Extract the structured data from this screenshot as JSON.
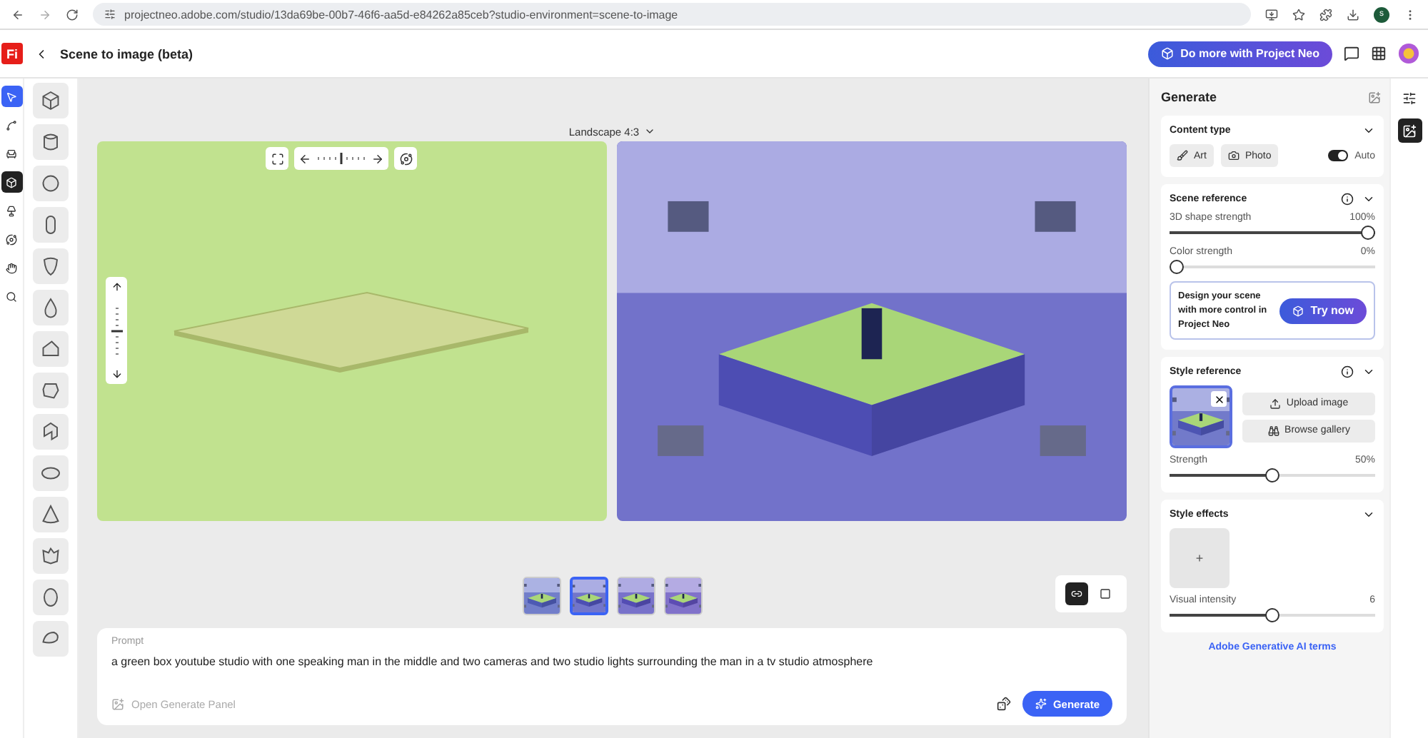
{
  "browser": {
    "url": "projectneo.adobe.com/studio/13da69be-00b7-46f6-aa5d-e84262a85ceb?studio-environment=scene-to-image",
    "avatar": "s"
  },
  "app": {
    "logo": "Fi",
    "title": "Scene to image (beta)",
    "promo_button": "Do more with Project Neo"
  },
  "tools": [
    {
      "kind": "pointer",
      "selected": true,
      "open": false
    },
    {
      "kind": "path",
      "selected": false,
      "open": false
    },
    {
      "kind": "objects",
      "selected": false,
      "open": false
    },
    {
      "kind": "cube",
      "selected": false,
      "open": true
    },
    {
      "kind": "lamp",
      "selected": false,
      "open": false
    },
    {
      "kind": "orbit",
      "selected": false,
      "open": false
    },
    {
      "kind": "hand",
      "selected": false,
      "open": false
    },
    {
      "kind": "zoom",
      "selected": false,
      "open": false
    }
  ],
  "canvas": {
    "aspect": "Landscape 4:3",
    "rotate": {
      "level": 0.5
    },
    "tilt": {
      "level": 0.5
    }
  },
  "thumbnails": [
    {
      "selected": false
    },
    {
      "selected": true
    },
    {
      "selected": false
    },
    {
      "selected": false
    }
  ],
  "view_modes": [
    {
      "kind": "split",
      "selected": true
    },
    {
      "kind": "single",
      "selected": false
    }
  ],
  "prompt": {
    "label": "Prompt",
    "value": "a green box youtube studio with one speaking man in the middle and two cameras and two studio lights surrounding the man in a tv studio atmosphere",
    "open_panel": "Open Generate Panel",
    "generate": "Generate"
  },
  "panel": {
    "title": "Generate",
    "content_type": {
      "title": "Content type",
      "options": [
        {
          "kind": "art",
          "label": "Art"
        },
        {
          "label": "Photo"
        }
      ],
      "auto": {
        "label": "Auto",
        "on": true
      }
    },
    "scene_reference": {
      "title": "Scene reference",
      "sliders": [
        {
          "label": "3D shape strength",
          "reading": "100%",
          "level": 1
        },
        {
          "label": "Color strength",
          "reading": "0%",
          "level": 0
        }
      ],
      "promo": {
        "text": "Design your scene with more control in Project Neo",
        "button": "Try now"
      }
    },
    "style_reference": {
      "title": "Style reference",
      "selected": true,
      "upload": "Upload image",
      "browse": "Browse gallery",
      "slider": {
        "label": "Strength",
        "reading": "50%",
        "level": 0.5
      }
    },
    "style_effects": {
      "title": "Style effects",
      "add": "+",
      "slider": {
        "label": "Visual intensity",
        "reading": "6",
        "level": 0.5
      }
    },
    "terms": "Adobe Generative AI terms"
  },
  "right_rail": [
    {
      "kind": "adjust",
      "selected": false
    },
    {
      "kind": "generate",
      "selected": true
    }
  ]
}
